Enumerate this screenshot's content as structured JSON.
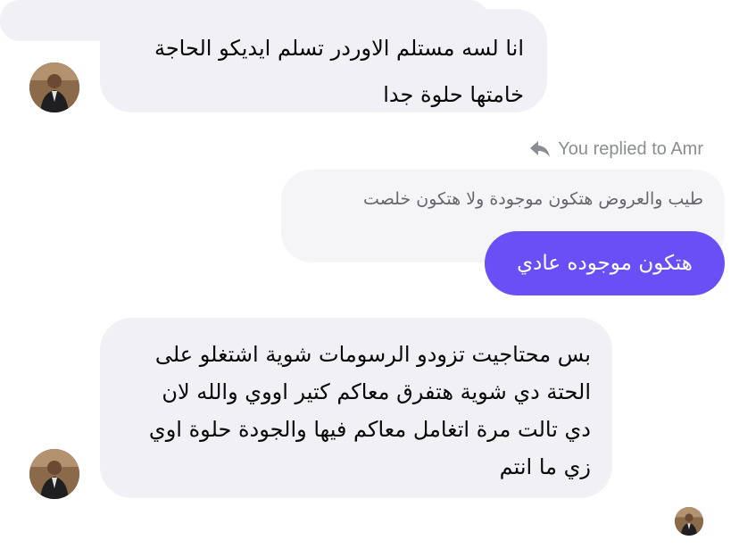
{
  "messages": {
    "incoming_1": {
      "lines": [
        "انا لسه مستلم الاوردر تسلم ايديكو الحاجة",
        "خامتها حلوة جدا"
      ]
    },
    "reply_context": "You replied to Amr",
    "quoted_message": "طيب والعروض هتكون موجودة ولا هتكون خلصت",
    "outgoing_1": "هتكون موجوده عادي",
    "incoming_2": {
      "lines": [
        "بس محتاجيت تزودو الرسومات شوية اشتغلو على",
        "الحتة دي شوية هتفرق معاكم كتير اووي والله لان",
        "دي تالت مرة اتغامل معاكم فيها والجودة حلوة اوي",
        "زي ما انتم"
      ]
    }
  },
  "colors": {
    "incoming_bubble": "#f0f0f5",
    "outgoing_bubble": "#6a4ff6",
    "meta_text": "#8a8d91"
  },
  "icons": {
    "reply": "reply-arrow-icon",
    "avatar": "user-avatar"
  }
}
